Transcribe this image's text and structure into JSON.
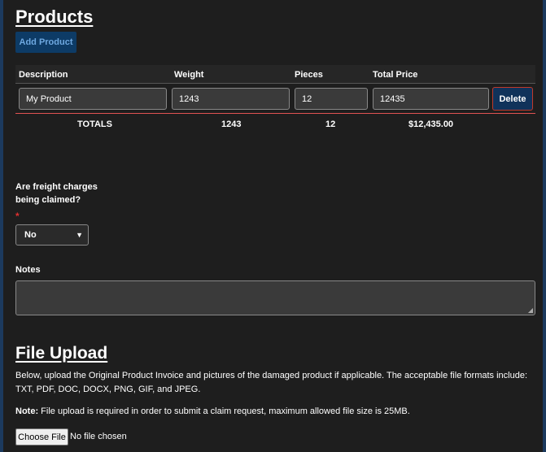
{
  "products": {
    "title": "Products",
    "add_label": "Add Product",
    "columns": [
      "Description",
      "Weight",
      "Pieces",
      "Total Price"
    ],
    "row": {
      "description": "My Product",
      "weight": "1243",
      "pieces": "12",
      "total_price": "12435"
    },
    "delete_label": "Delete",
    "totals": {
      "label": "TOTALS",
      "weight": "1243",
      "pieces": "12",
      "price": "$12,435.00"
    }
  },
  "freight": {
    "question_line1": "Are freight charges",
    "question_line2": "being claimed?",
    "required_mark": "*",
    "selected": "No"
  },
  "notes": {
    "label": "Notes",
    "value": ""
  },
  "upload": {
    "title": "File Upload",
    "description": "Below, upload the Original Product Invoice and pictures of the damaged product if applicable. The acceptable file formats include: TXT, PDF, DOC, DOCX, PNG, GIF, and JPEG.",
    "note_bold": "Note:",
    "note_text": " File upload is required in order to submit a claim request, maximum allowed file size is 25MB.",
    "choose_label": "Choose File",
    "no_file": "No file chosen"
  }
}
